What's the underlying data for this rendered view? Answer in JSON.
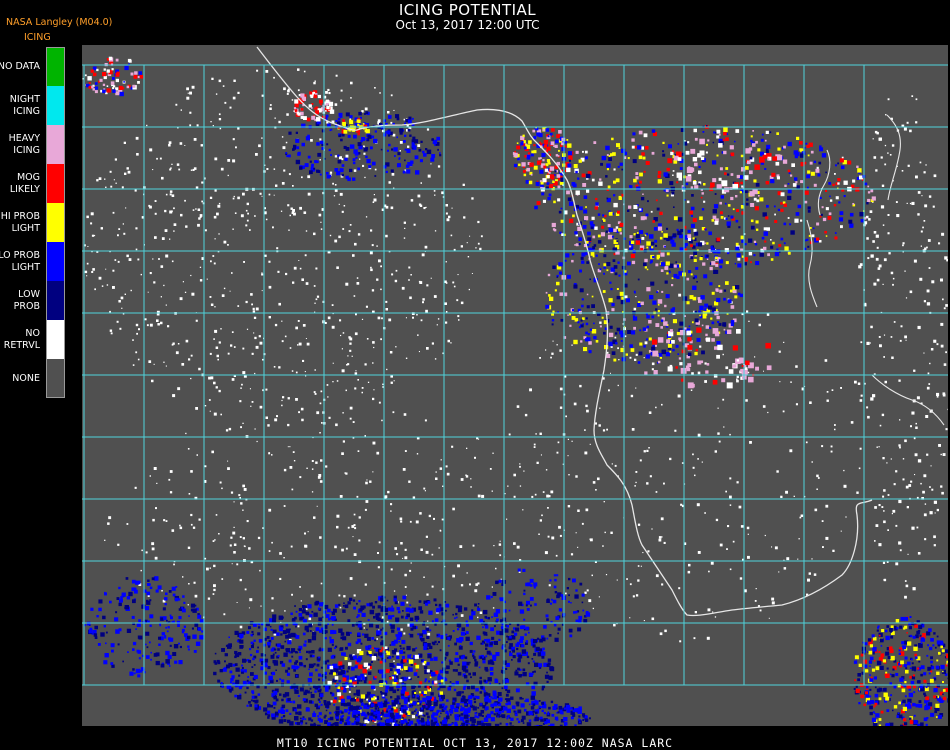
{
  "header": {
    "title": "ICING POTENTIAL",
    "subtitle": "Oct 13, 2017 12:00 UTC",
    "source": "NASA Langley (M04.0)"
  },
  "legend": {
    "title": "ICING",
    "items": [
      {
        "label": "NO DATA",
        "color": "#00b400"
      },
      {
        "label": "NIGHT\nICING",
        "color": "#00e8ee"
      },
      {
        "label": "HEAVY\nICING",
        "color": "#e8a8d8"
      },
      {
        "label": "MOG\nLIKELY",
        "color": "#ff0000"
      },
      {
        "label": "HI PROB\nLIGHT",
        "color": "#ffff00"
      },
      {
        "label": "LO PROB\nLIGHT",
        "color": "#0000ff"
      },
      {
        "label": "LOW\nPROB",
        "color": "#000080"
      },
      {
        "label": "NO\nRETRVL",
        "color": "#ffffff"
      },
      {
        "label": "NONE",
        "color": "#505050"
      }
    ]
  },
  "map": {
    "background_color": "#505050",
    "grid_color": "#4fd3dc",
    "label_color": "#d23030",
    "coastline_color": "#e6e6e6",
    "region": "Atlantic Ocean and Southern Africa"
  },
  "footer": {
    "text": "MT10  ICING POTENTIAL   OCT 13, 2017 12:00Z   NASA LARC"
  }
}
